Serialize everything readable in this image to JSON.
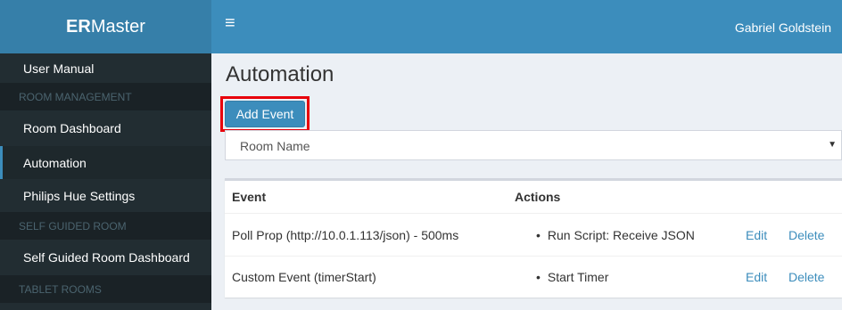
{
  "brand": {
    "bold": "ER",
    "rest": "Master"
  },
  "header": {
    "toggle_icon": "hamburger-icon",
    "user_name": "Gabriel Goldstein"
  },
  "sidebar": {
    "items": [
      {
        "label": "User Manual"
      },
      {
        "header": "ROOM MANAGEMENT"
      },
      {
        "label": "Room Dashboard"
      },
      {
        "label": "Automation",
        "active": true
      },
      {
        "label": "Philips Hue Settings"
      },
      {
        "header": "SELF GUIDED ROOM"
      },
      {
        "label": "Self Guided Room Dashboard"
      },
      {
        "header": "TABLET ROOMS"
      }
    ]
  },
  "main": {
    "title": "Automation",
    "add_button": "Add Event",
    "room_select": {
      "selected": "Room Name"
    },
    "table": {
      "headers": {
        "event": "Event",
        "actions": "Actions"
      },
      "rows": [
        {
          "event": "Poll Prop (http://10.0.1.113/json) - 500ms",
          "action": "Run Script: Receive JSON",
          "edit": "Edit",
          "delete": "Delete"
        },
        {
          "event": "Custom Event (timerStart)",
          "action": "Start Timer",
          "edit": "Edit",
          "delete": "Delete"
        }
      ]
    }
  },
  "colors": {
    "header_bg": "#3c8dbc",
    "brand_bg": "#367fa9",
    "sidebar_bg": "#222d32",
    "highlight": "#e8000b"
  }
}
